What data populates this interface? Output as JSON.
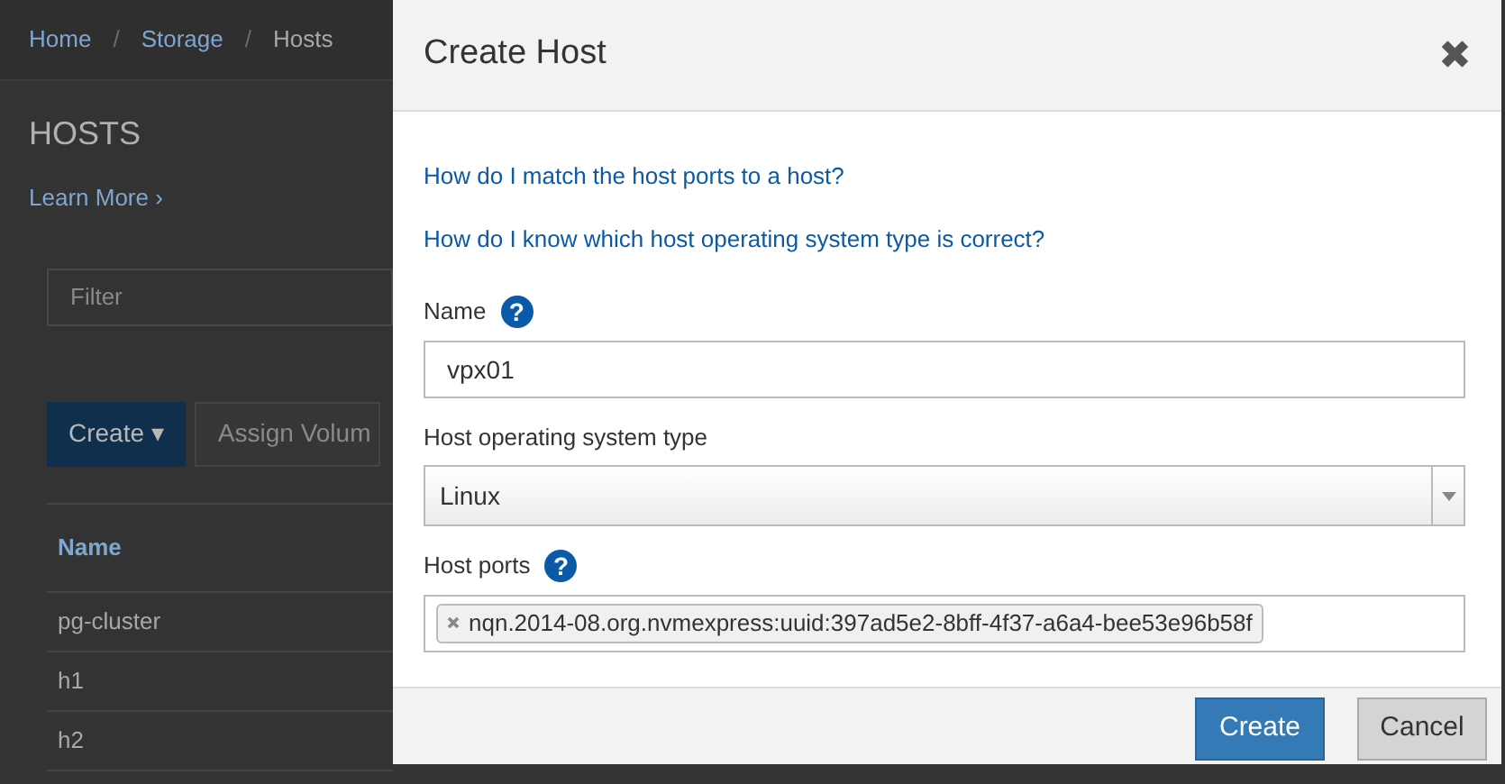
{
  "page": {
    "breadcrumb": [
      "Home",
      "Storage",
      "Hosts"
    ],
    "breadcrumb_separator": "/",
    "title": "HOSTS",
    "learn_more": "Learn More ›",
    "filter": {
      "placeholder": "Filter"
    },
    "buttons": [
      {
        "label": "Create ▾",
        "kind": "primary"
      },
      {
        "label": "Assign Volum",
        "kind": "secondary"
      }
    ],
    "table": {
      "columns": [
        "Name"
      ],
      "rows": [
        "pg-cluster",
        "h1",
        "h2"
      ]
    }
  },
  "dialog": {
    "title": "Create Host",
    "close": "✖",
    "links": [
      "How do I match the host ports to a host?",
      "How do I know which host operating system type is correct?"
    ],
    "fields": [
      {
        "kind": "text",
        "label": "Name",
        "help": "?",
        "value": "vpx01"
      },
      {
        "kind": "select",
        "label": "Host operating system type",
        "value": "Linux"
      },
      {
        "kind": "tags",
        "label": "Host ports",
        "help": "?",
        "tags": [
          "nqn.2014-08.org.nvmexpress:uuid:397ad5e2-8bff-4f37-a6a4-bee53e96b58f"
        ]
      }
    ],
    "buttons": [
      {
        "label": "Create",
        "kind": "primary"
      },
      {
        "label": "Cancel",
        "kind": "secondary"
      }
    ]
  }
}
